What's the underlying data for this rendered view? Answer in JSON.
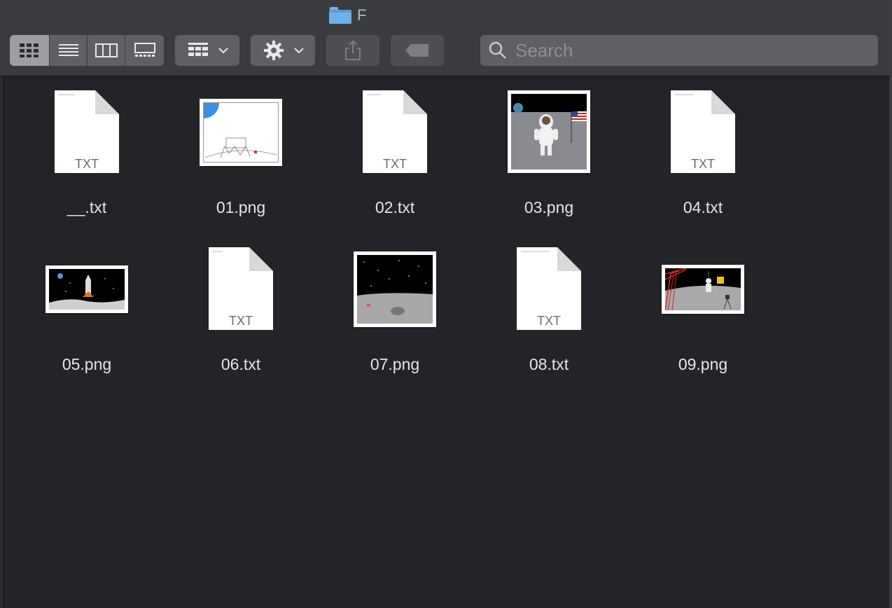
{
  "window": {
    "title": "F"
  },
  "toolbar": {
    "view_icons": "icon-view-icon",
    "view_list": "list-view-icon",
    "view_columns": "column-view-icon",
    "view_gallery": "gallery-view-icon",
    "group_by": "group-by-icon",
    "action": "gear-icon",
    "share": "share-icon",
    "tags": "tag-icon"
  },
  "search": {
    "placeholder": "Search"
  },
  "files": [
    {
      "name": "__.txt",
      "kind": "txt",
      "badge": "TXT"
    },
    {
      "name": "01.png",
      "kind": "png"
    },
    {
      "name": "02.txt",
      "kind": "txt",
      "badge": "TXT"
    },
    {
      "name": "03.png",
      "kind": "png"
    },
    {
      "name": "04.txt",
      "kind": "txt",
      "badge": "TXT"
    },
    {
      "name": "05.png",
      "kind": "png"
    },
    {
      "name": "06.txt",
      "kind": "txt",
      "badge": "TXT"
    },
    {
      "name": "07.png",
      "kind": "png"
    },
    {
      "name": "08.txt",
      "kind": "txt",
      "badge": "TXT"
    },
    {
      "name": "09.png",
      "kind": "png"
    }
  ],
  "colors": {
    "accent": "#5a9bd6",
    "background": "#232428",
    "toolbar": "#3a3b3f"
  }
}
